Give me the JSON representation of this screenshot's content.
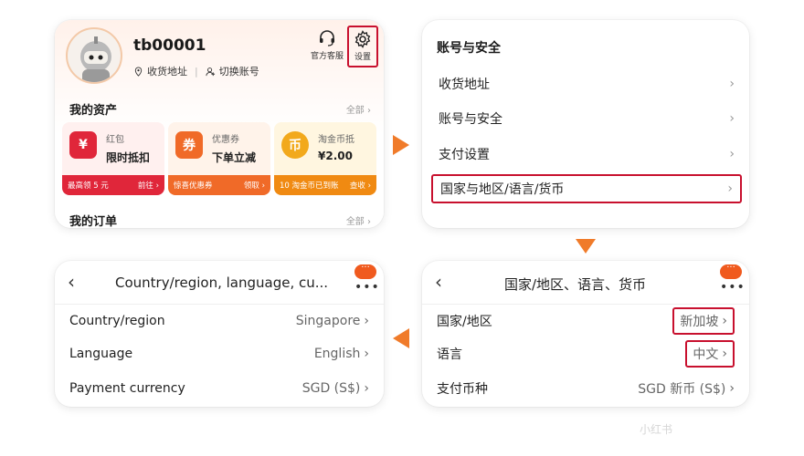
{
  "profile": {
    "username": "tb00001",
    "address_link": "收货地址",
    "switch_link": "切换账号",
    "service_label": "官方客服",
    "settings_label": "设置",
    "assets_title": "我的资产",
    "assets_more": "全部",
    "orders_title": "我的订单",
    "orders_more": "全部",
    "assets": [
      {
        "icon": "¥",
        "label": "红包",
        "value": "限时抵扣",
        "footer_left": "最高领 5 元",
        "footer_right": "前往"
      },
      {
        "icon": "券",
        "label": "优惠券",
        "value": "下单立减",
        "footer_left": "惊喜优惠券",
        "footer_right": "领取"
      },
      {
        "icon": "币",
        "label": "淘金币抵",
        "value": "¥2.00",
        "footer_left": "10 淘金币已到账",
        "footer_right": "查收"
      }
    ]
  },
  "account": {
    "title": "账号与安全",
    "items": [
      "收货地址",
      "账号与安全",
      "支付设置",
      "国家与地区/语言/货币"
    ]
  },
  "region_cn": {
    "title": "国家/地区、语言、货币",
    "rows": [
      {
        "label": "国家/地区",
        "value": "新加坡"
      },
      {
        "label": "语言",
        "value": "中文"
      },
      {
        "label": "支付币种",
        "value": "SGD 新币 (S$)"
      }
    ]
  },
  "region_en": {
    "title": "Country/region, language, cu...",
    "rows": [
      {
        "label": "Country/region",
        "value": "Singapore"
      },
      {
        "label": "Language",
        "value": "English"
      },
      {
        "label": "Payment currency",
        "value": "SGD (S$)"
      }
    ]
  },
  "menu_bubble": "···",
  "watermark": "小红书",
  "colors": {
    "accent": "#f07b2a",
    "highlight": "#c8102e",
    "red": "#e0263a"
  }
}
